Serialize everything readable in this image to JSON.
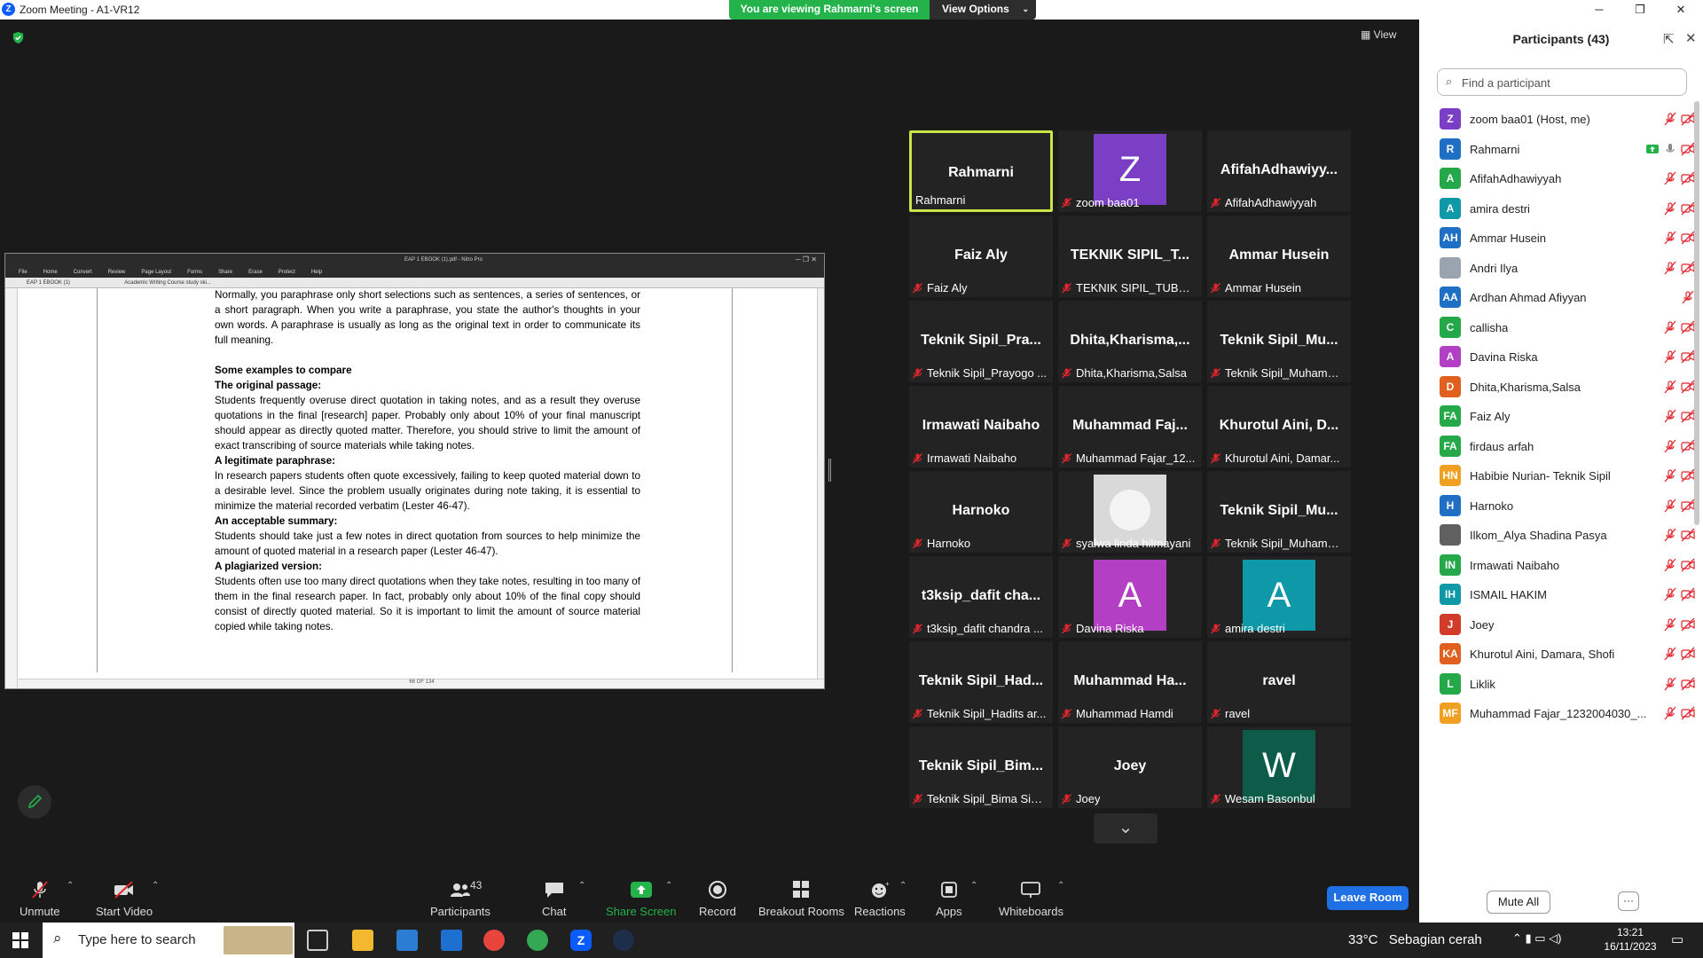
{
  "window": {
    "title": "Zoom Meeting - A1-VR12",
    "minimize": "─",
    "restore": "❐",
    "close": "✕"
  },
  "banner": {
    "viewing": "You are viewing Rahmarni's screen",
    "view_options": "View Options"
  },
  "view_label": "View",
  "shared_doc": {
    "title": "EAP 1 EBOOK (1).pdf - Nitro Pro",
    "ribbon": [
      "File",
      "Home",
      "Convert",
      "Review",
      "Page Layout",
      "Forms",
      "Share",
      "Erase",
      "Protect",
      "Help"
    ],
    "tabs": [
      "EAP 1 EBOOK (1)",
      "Academic Writing Course study ski..."
    ],
    "status": "66 OF 134",
    "paragraphs": [
      {
        "bold": false,
        "text": "Normally, you paraphrase only short selections such as sentences, a series of sentences, or a short paragraph. When you write a paraphrase, you state the author's thoughts in your own words. A paraphrase is usually as long as the original text in order to communicate its full meaning."
      },
      {
        "bold": true,
        "text": ""
      },
      {
        "bold": true,
        "text": "Some examples to compare"
      },
      {
        "bold": true,
        "text": "The original passage:"
      },
      {
        "bold": false,
        "text": "Students frequently overuse direct quotation in taking notes, and as a result they overuse quotations in the final [research] paper. Probably only about 10% of your final manuscript should appear as directly quoted matter. Therefore, you should strive to limit the amount of exact transcribing of source materials while taking notes."
      },
      {
        "bold": true,
        "text": "A legitimate paraphrase:"
      },
      {
        "bold": false,
        "text": "In research papers students often quote excessively, failing to keep quoted material down to a desirable level. Since the problem usually originates during note taking, it is essential to minimize the material recorded verbatim (Lester 46-47)."
      },
      {
        "bold": true,
        "text": "An acceptable summary:"
      },
      {
        "bold": false,
        "text": "Students should take just a few notes in direct quotation from sources to help minimize the amount of quoted material in a research paper (Lester 46-47)."
      },
      {
        "bold": true,
        "text": "A plagiarized version:"
      },
      {
        "bold": false,
        "text": "Students often use too many direct quotations when they take notes, resulting in too many of them in the final research paper. In fact, probably only about 10% of the final copy should consist of directly quoted material. So it is important to limit the amount of source material copied while taking notes."
      }
    ]
  },
  "gallery": [
    {
      "big": "Rahmarni",
      "label": "Rahmarni",
      "muted": false,
      "avatar": "",
      "avatar_color": ""
    },
    {
      "big": "",
      "label": "zoom baa01",
      "muted": true,
      "avatar": "Z",
      "avatar_color": "#7a3fc4"
    },
    {
      "big": "AfifahAdhawiyy...",
      "label": "AfifahAdhawiyyah",
      "muted": true,
      "avatar": "",
      "avatar_color": ""
    },
    {
      "big": "Faiz Aly",
      "label": "Faiz Aly",
      "muted": true,
      "avatar": "",
      "avatar_color": ""
    },
    {
      "big": "TEKNIK SIPIL_T...",
      "label": "TEKNIK SIPIL_TUBAG...",
      "muted": true,
      "avatar": "",
      "avatar_color": ""
    },
    {
      "big": "Ammar Husein",
      "label": "Ammar Husein",
      "muted": true,
      "avatar": "",
      "avatar_color": ""
    },
    {
      "big": "Teknik Sipil_Pra...",
      "label": "Teknik Sipil_Prayogo ...",
      "muted": true,
      "avatar": "",
      "avatar_color": ""
    },
    {
      "big": "Dhita,Kharisma,...",
      "label": "Dhita,Kharisma,Salsa",
      "muted": true,
      "avatar": "",
      "avatar_color": ""
    },
    {
      "big": "Teknik Sipil_Mu...",
      "label": "Teknik Sipil_Muhamm...",
      "muted": true,
      "avatar": "",
      "avatar_color": ""
    },
    {
      "big": "Irmawati Naibaho",
      "label": "Irmawati Naibaho",
      "muted": true,
      "avatar": "",
      "avatar_color": ""
    },
    {
      "big": "Muhammad Faj...",
      "label": "Muhammad Fajar_12...",
      "muted": true,
      "avatar": "",
      "avatar_color": ""
    },
    {
      "big": "Khurotul Aini, D...",
      "label": "Khurotul Aini, Damar...",
      "muted": true,
      "avatar": "",
      "avatar_color": ""
    },
    {
      "big": "Harnoko",
      "label": "Harnoko",
      "muted": true,
      "avatar": "",
      "avatar_color": ""
    },
    {
      "big": "",
      "label": "syalwa linda hilmayani",
      "muted": true,
      "avatar": "photo",
      "avatar_color": "#d9d9d9"
    },
    {
      "big": "Teknik Sipil_Mu...",
      "label": "Teknik Sipil_Muhamm...",
      "muted": true,
      "avatar": "",
      "avatar_color": ""
    },
    {
      "big": "t3ksip_dafit cha...",
      "label": "t3ksip_dafit chandra ...",
      "muted": true,
      "avatar": "",
      "avatar_color": ""
    },
    {
      "big": "",
      "label": "Davina Riska",
      "muted": true,
      "avatar": "A",
      "avatar_color": "#b23fc4"
    },
    {
      "big": "",
      "label": "amira destri",
      "muted": true,
      "avatar": "A",
      "avatar_color": "#0f99a8"
    },
    {
      "big": "Teknik Sipil_Had...",
      "label": "Teknik Sipil_Hadits ar...",
      "muted": true,
      "avatar": "",
      "avatar_color": ""
    },
    {
      "big": "Muhammad Ha...",
      "label": "Muhammad Hamdi",
      "muted": true,
      "avatar": "",
      "avatar_color": ""
    },
    {
      "big": "ravel",
      "label": "ravel",
      "muted": true,
      "avatar": "",
      "avatar_color": ""
    },
    {
      "big": "Teknik Sipil_Bim...",
      "label": "Teknik Sipil_Bima Sisw...",
      "muted": true,
      "avatar": "",
      "avatar_color": ""
    },
    {
      "big": "Joey",
      "label": "Joey",
      "muted": true,
      "avatar": "",
      "avatar_color": ""
    },
    {
      "big": "",
      "label": "Wesam Basonbul",
      "muted": true,
      "avatar": "W",
      "avatar_color": "#0d5c4a"
    }
  ],
  "panel": {
    "title": "Participants (43)",
    "search_placeholder": "Find a participant",
    "mute_all": "Mute All",
    "more": "···",
    "participants": [
      {
        "initials": "Z",
        "name": "zoom baa01 (Host, me)",
        "color": "#7a3fc4",
        "icons": "mute-video"
      },
      {
        "initials": "R",
        "name": "Rahmarni",
        "color": "#1f6fc4",
        "icons": "share"
      },
      {
        "initials": "A",
        "name": "AfifahAdhawiyyah",
        "color": "#24a84a",
        "icons": "mute-video"
      },
      {
        "initials": "A",
        "name": "amira destri",
        "color": "#0f99a8",
        "icons": "mute-video"
      },
      {
        "initials": "AH",
        "name": "Ammar Husein",
        "color": "#1f6fc4",
        "icons": "mute-video"
      },
      {
        "initials": "",
        "name": "Andri Ilya",
        "color": "#9aa3b0",
        "icons": "mute-video"
      },
      {
        "initials": "AA",
        "name": "Ardhan Ahmad Afiyyan",
        "color": "#1f6fc4",
        "icons": "mute"
      },
      {
        "initials": "C",
        "name": "callisha",
        "color": "#24a84a",
        "icons": "mute-video"
      },
      {
        "initials": "A",
        "name": "Davina Riska",
        "color": "#b23fc4",
        "icons": "mute-video"
      },
      {
        "initials": "D",
        "name": "Dhita,Kharisma,Salsa",
        "color": "#e0611f",
        "icons": "mute-video"
      },
      {
        "initials": "FA",
        "name": "Faiz Aly",
        "color": "#24a84a",
        "icons": "mute-video"
      },
      {
        "initials": "FA",
        "name": "firdaus arfah",
        "color": "#24a84a",
        "icons": "mute-video"
      },
      {
        "initials": "HN",
        "name": "Habibie Nurian- Teknik Sipil",
        "color": "#f0a020",
        "icons": "mute-video"
      },
      {
        "initials": "H",
        "name": "Harnoko",
        "color": "#1f6fc4",
        "icons": "mute-video"
      },
      {
        "initials": "",
        "name": "Ilkom_Alya Shadina Pasya",
        "color": "#606060",
        "icons": "mute-video"
      },
      {
        "initials": "IN",
        "name": "Irmawati Naibaho",
        "color": "#24a84a",
        "icons": "mute-video"
      },
      {
        "initials": "IH",
        "name": "ISMAIL HAKIM",
        "color": "#0f99a8",
        "icons": "mute-video"
      },
      {
        "initials": "J",
        "name": "Joey",
        "color": "#d23a2a",
        "icons": "mute-video"
      },
      {
        "initials": "KA",
        "name": "Khurotul Aini, Damara, Shofi",
        "color": "#e0611f",
        "icons": "mute-video"
      },
      {
        "initials": "L",
        "name": "Liklik",
        "color": "#24a84a",
        "icons": "mute-video"
      },
      {
        "initials": "MF",
        "name": "Muhammad Fajar_1232004030_...",
        "color": "#f0a020",
        "icons": "mute-video"
      }
    ]
  },
  "toolbar": {
    "unmute": "Unmute",
    "start_video": "Start Video",
    "participants": "Participants",
    "participants_count": "43",
    "chat": "Chat",
    "share_screen": "Share Screen",
    "record": "Record",
    "breakout": "Breakout Rooms",
    "reactions": "Reactions",
    "apps": "Apps",
    "whiteboards": "Whiteboards",
    "leave": "Leave Room"
  },
  "taskbar": {
    "search_placeholder": "Type here to search",
    "weather_temp": "33°C",
    "weather_desc": "Sebagian cerah",
    "time": "13:21",
    "date": "16/11/2023"
  },
  "colors": {
    "accent_green": "#24b34b",
    "active_border": "#c8e446",
    "leave_blue": "#1f6fe5",
    "mute_red": "#e0252d"
  }
}
